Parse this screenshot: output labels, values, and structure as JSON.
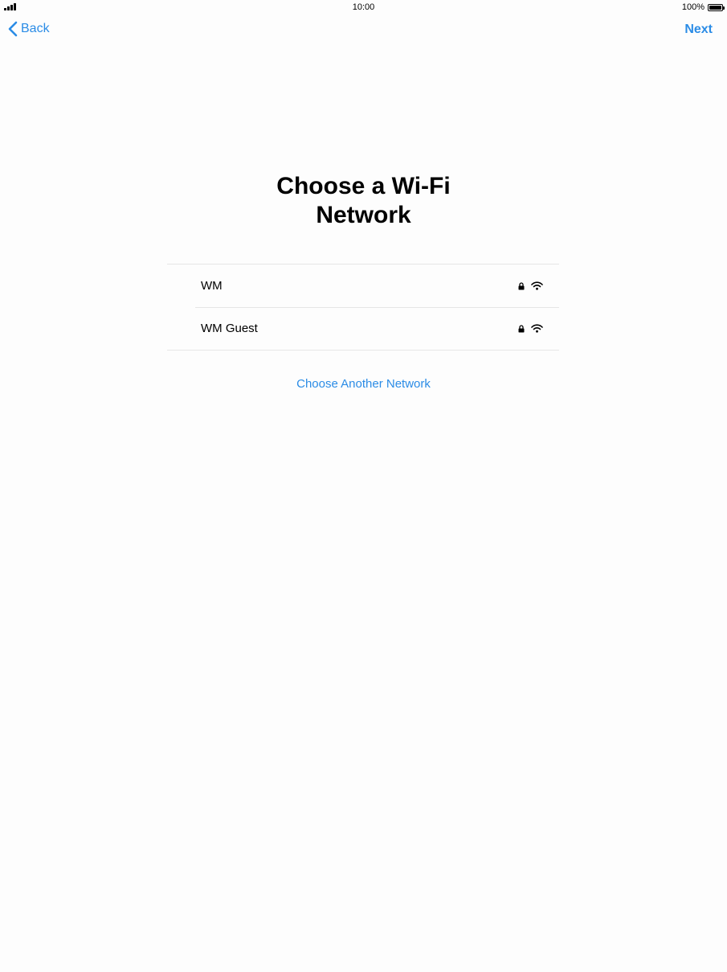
{
  "status_bar": {
    "time": "10:00",
    "battery_percent": "100%",
    "signal_icon": "cellular-signal-icon",
    "battery_icon": "battery-full-icon"
  },
  "nav": {
    "back_label": "Back",
    "back_icon": "chevron-left-icon",
    "next_label": "Next"
  },
  "page": {
    "title_line1": "Choose a Wi-Fi",
    "title_line2": "Network"
  },
  "networks": [
    {
      "name": "WM",
      "secured": true,
      "signal": "full",
      "lock_icon": "lock-icon",
      "wifi_icon": "wifi-icon"
    },
    {
      "name": "WM Guest",
      "secured": true,
      "signal": "full",
      "lock_icon": "lock-icon",
      "wifi_icon": "wifi-icon"
    }
  ],
  "other_network_label": "Choose Another Network",
  "colors": {
    "accent": "#2b8ce6",
    "background": "#fdfdfd",
    "separator": "#e6e6e6"
  }
}
